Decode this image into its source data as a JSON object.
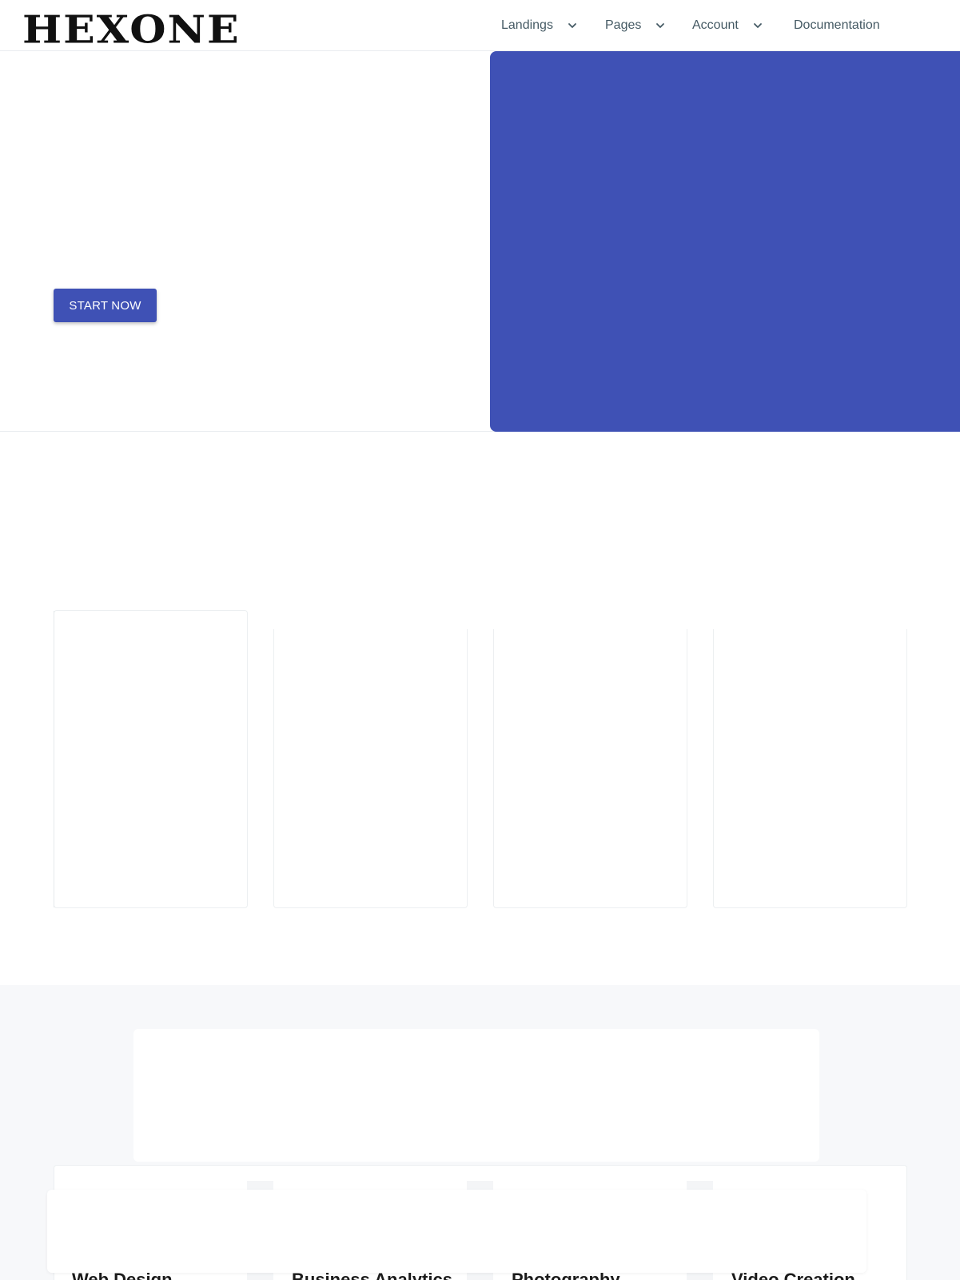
{
  "header": {
    "logo_text": "HEXONE",
    "nav": [
      {
        "label": "Landings",
        "has_dropdown": true
      },
      {
        "label": "Pages",
        "has_dropdown": true
      },
      {
        "label": "Account",
        "has_dropdown": true
      },
      {
        "label": "Documentation",
        "has_dropdown": false
      }
    ]
  },
  "hero": {
    "cta_label": "START NOW",
    "panel_color": "#3f51b5"
  },
  "services": [
    {
      "title": "Web Design"
    },
    {
      "title": "Business Analytics"
    },
    {
      "title": "Photography"
    },
    {
      "title": "Video Creation"
    }
  ],
  "colors": {
    "primary": "#3f51b5",
    "nav_text": "#455a64",
    "section_gray": "#f7f8fa"
  },
  "icons": {
    "dropdown": "chevron-down-icon"
  }
}
